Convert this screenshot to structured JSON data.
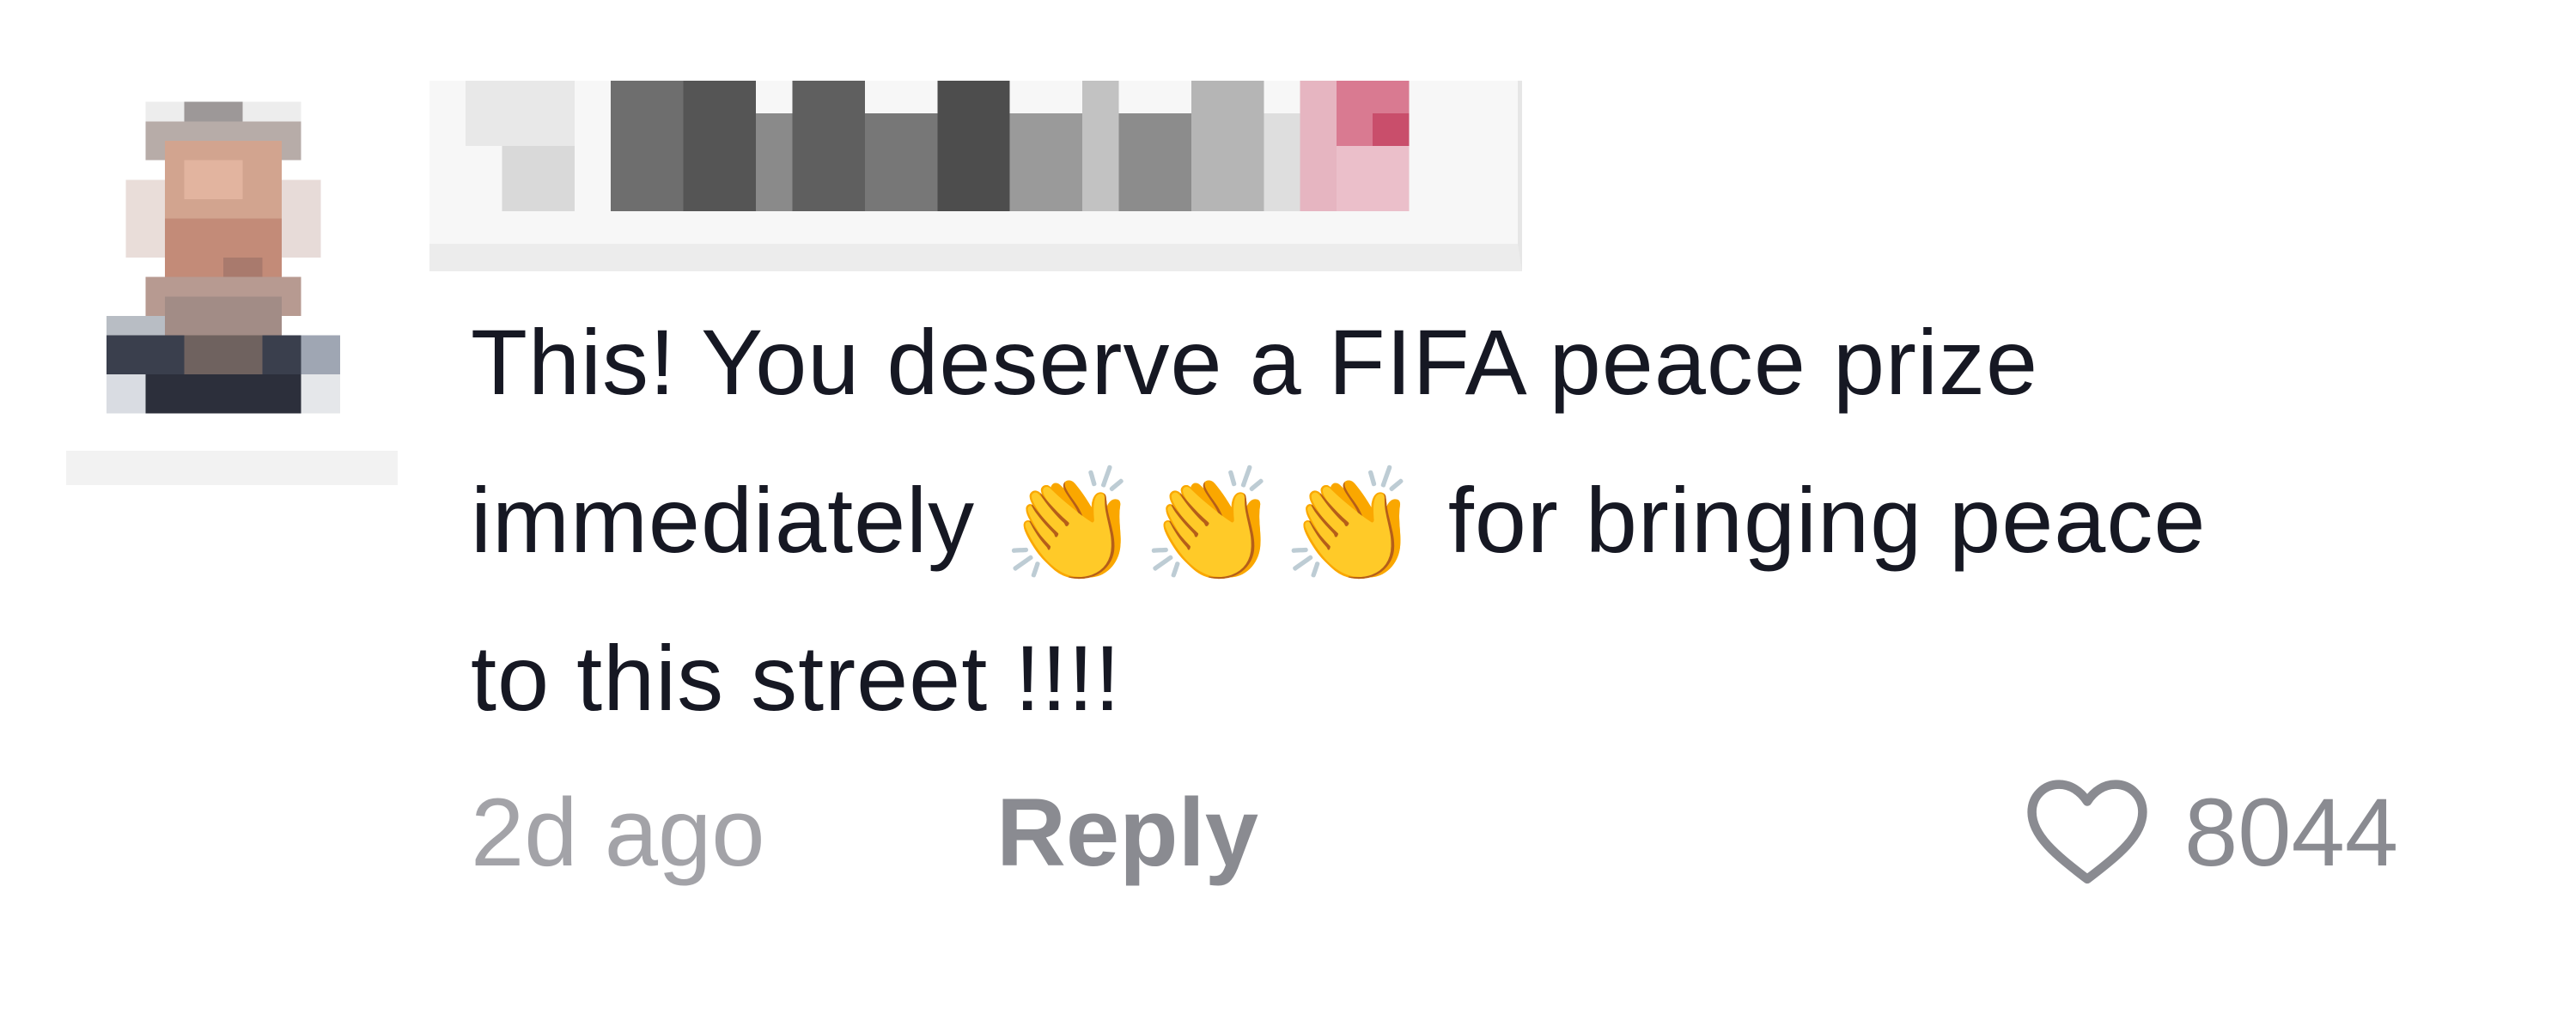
{
  "comment": {
    "lines": [
      "This! You deserve a FIFA peace prize",
      "immediately",
      "for bringing peace",
      "to this street !!!!"
    ],
    "emoji": "👏👏👏",
    "timestamp": "2d ago",
    "reply_label": "Reply",
    "like_count": "8044"
  },
  "icons": {
    "avatar": "pixelated-avatar",
    "username": "pixelated-username",
    "like": "heart-outline-icon"
  },
  "colors": {
    "text": "#161823",
    "muted": "#a3a3a8",
    "reply": "#8a8b91",
    "accent_pink": "#d9607a"
  }
}
